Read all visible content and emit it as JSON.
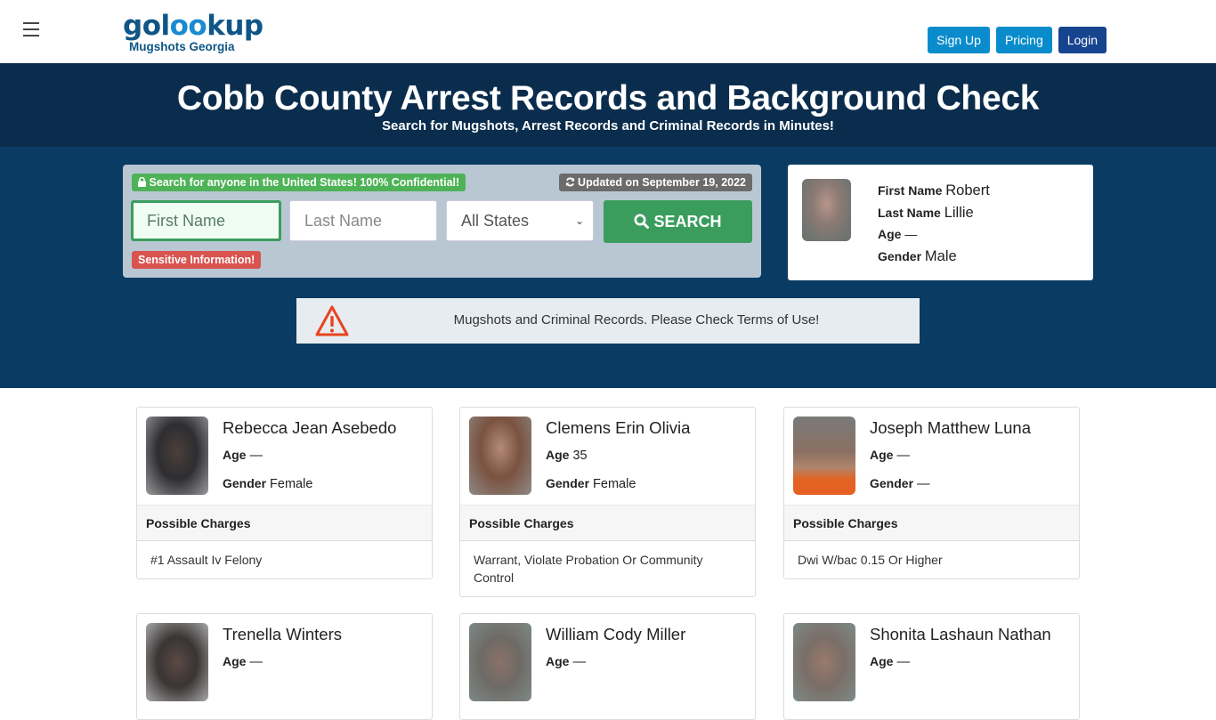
{
  "navbar": {
    "logo_text_a": "gol",
    "logo_text_b": "oo",
    "logo_text_c": "kup",
    "logo_subtitle": "Mugshots Georgia",
    "buttons": [
      {
        "label": "Sign Up"
      },
      {
        "label": "Pricing"
      },
      {
        "label": "Login"
      }
    ],
    "colors": {
      "signup": "#0a8ccc",
      "pricing": "#0a8ccc",
      "login": "#17448f"
    }
  },
  "hero": {
    "title": "Cobb County Arrest Records and Background Check",
    "subtitle": "Search for Mugshots, Arrest Records and Criminal Records in Minutes!"
  },
  "search": {
    "confidential_badge": "Search for anyone in the United States! 100% Confidential!",
    "updated_badge": "Updated on September 19, 2022",
    "first_name_placeholder": "First Name",
    "last_name_placeholder": "Last Name",
    "state_selected": "All States",
    "search_button": "SEARCH",
    "sensitive_badge": "Sensitive Information!"
  },
  "profile": {
    "first_name_label": "First Name",
    "first_name": "Robert",
    "last_name_label": "Last Name",
    "last_name": "Lillie",
    "age_label": "Age",
    "age": "—",
    "gender_label": "Gender",
    "gender": "Male"
  },
  "notice": {
    "text": "Mugshots and Criminal Records. Please Check Terms of Use!"
  },
  "labels": {
    "age": "Age",
    "gender": "Gender",
    "possible_charges": "Possible Charges"
  },
  "records": [
    {
      "name": "Rebecca Jean Asebedo",
      "age": "—",
      "gender": "Female",
      "charges": "#1 Assault Iv Felony"
    },
    {
      "name": "Clemens Erin Olivia",
      "age": "35",
      "gender": "Female",
      "charges": "Warrant, Violate Probation Or Community Control"
    },
    {
      "name": "Joseph Matthew Luna",
      "age": "—",
      "gender": "—",
      "charges": "Dwi W/bac 0.15 Or Higher"
    },
    {
      "name": "Trenella Winters",
      "age": "—"
    },
    {
      "name": "William Cody Miller",
      "age": "—"
    },
    {
      "name": "Shonita Lashaun Nathan",
      "age": "—"
    }
  ]
}
